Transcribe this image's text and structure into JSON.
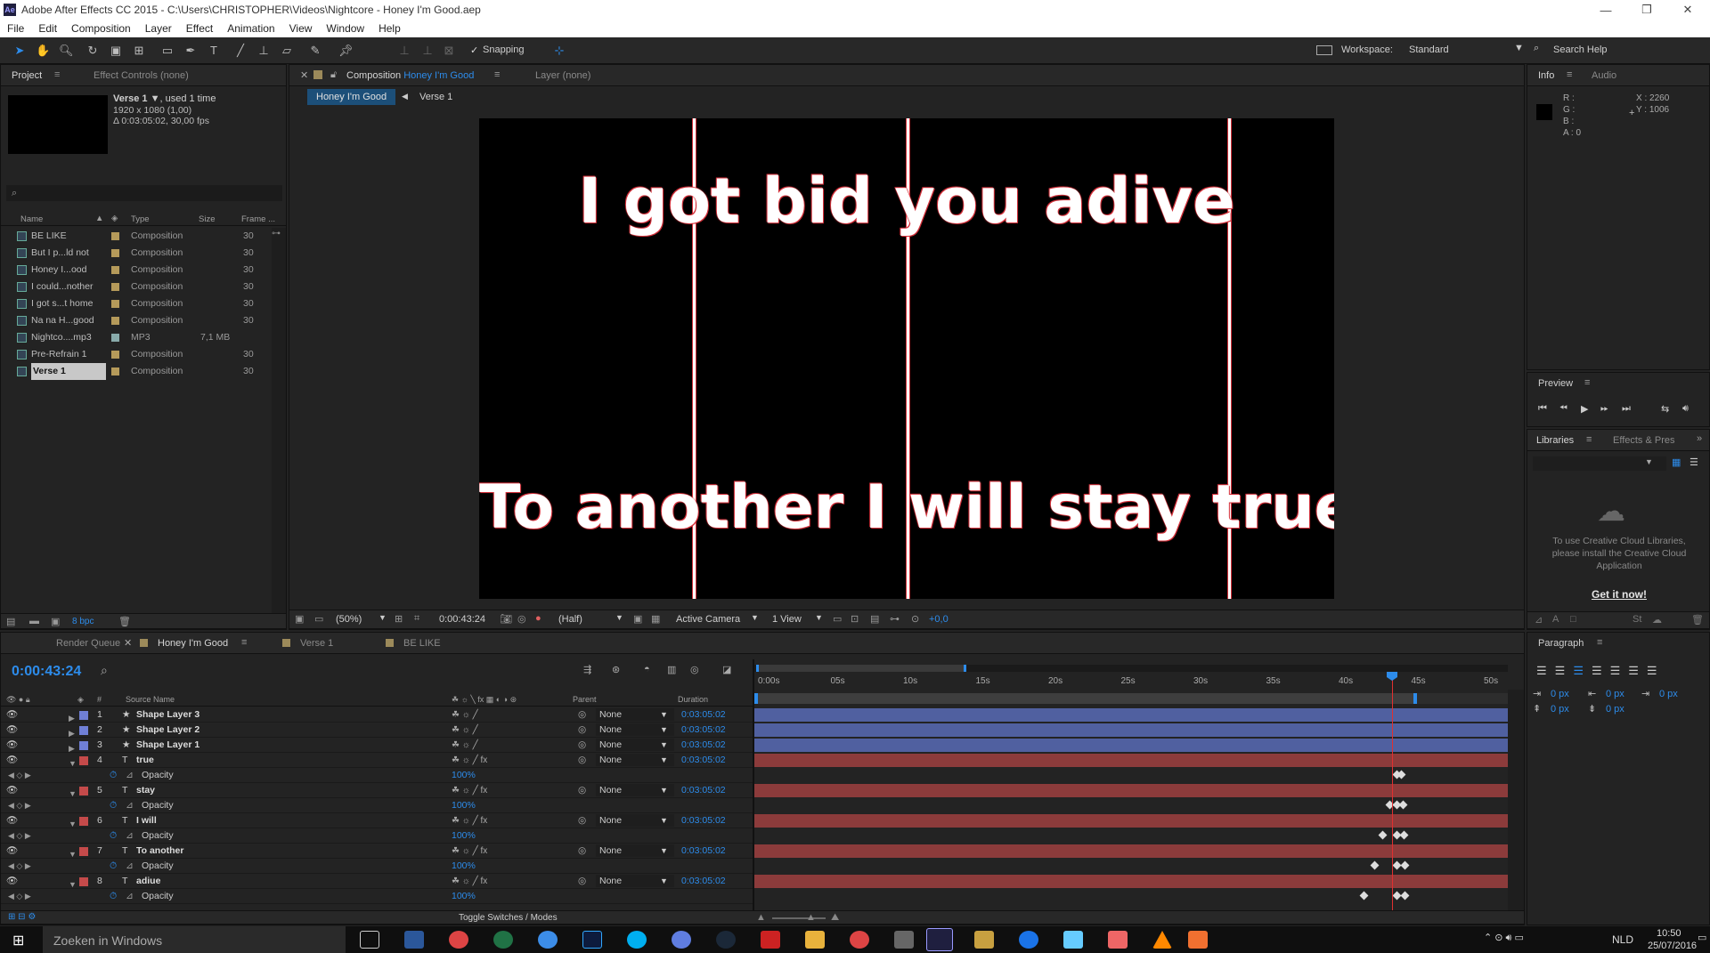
{
  "window": {
    "app_badge": "Ae",
    "title": "Adobe After Effects CC 2015 - C:\\Users\\CHRISTOPHER\\Videos\\Nightcore - Honey I'm Good.aep",
    "min": "—",
    "max": "❐",
    "close": "✕"
  },
  "menu": [
    "File",
    "Edit",
    "Composition",
    "Layer",
    "Effect",
    "Animation",
    "View",
    "Window",
    "Help"
  ],
  "toolbar": {
    "snapping": "Snapping",
    "workspace_label": "Workspace:",
    "workspace_value": "Standard",
    "search_help": "Search Help"
  },
  "project": {
    "tabs": {
      "project": "Project",
      "effect_controls": "Effect Controls (none)"
    },
    "selected_name": "Verse 1 ▼",
    "used": ", used 1 time",
    "dims": "1920 x 1080 (1,00)",
    "duration": "Δ 0:03:05:02, 30,00 fps",
    "columns": {
      "name": "Name",
      "type": "Type",
      "size": "Size",
      "frame": "Frame ..."
    },
    "items": [
      {
        "name": "BE LIKE",
        "type": "Composition",
        "size": "",
        "frame": "30"
      },
      {
        "name": "But I p...ld not",
        "type": "Composition",
        "size": "",
        "frame": "30"
      },
      {
        "name": "Honey I...ood",
        "type": "Composition",
        "size": "",
        "frame": "30"
      },
      {
        "name": "I could...nother",
        "type": "Composition",
        "size": "",
        "frame": "30"
      },
      {
        "name": "I got s...t home",
        "type": "Composition",
        "size": "",
        "frame": "30"
      },
      {
        "name": "Na na H...good",
        "type": "Composition",
        "size": "",
        "frame": "30"
      },
      {
        "name": "Nightco....mp3",
        "type": "MP3",
        "size": "7,1 MB",
        "frame": ""
      },
      {
        "name": "Pre-Refrain 1",
        "type": "Composition",
        "size": "",
        "frame": "30"
      },
      {
        "name": "Verse 1",
        "type": "Composition",
        "size": "",
        "frame": "30"
      }
    ],
    "bpc": "8 bpc"
  },
  "comp": {
    "tab_prefix": "Composition",
    "tab_name": "Honey I'm Good",
    "layer_tab": "Layer (none)",
    "crumb_active": "Honey I'm Good",
    "crumb_next": "Verse 1",
    "text_top": "I got bid you adive",
    "text_bottom": "To another I will stay true",
    "zoom": "(50%)",
    "time": "0:00:43:24",
    "resolution": "(Half)",
    "camera": "Active Camera",
    "views": "1 View",
    "exposure": "+0,0"
  },
  "info": {
    "tab": "Info",
    "tab2": "Audio",
    "r": "R :",
    "g": "G :",
    "b": "B :",
    "a": "A : 0",
    "x": "X : 2260",
    "y": "Y : 1006"
  },
  "preview": {
    "title": "Preview"
  },
  "libraries": {
    "tab": "Libraries",
    "tab2": "Effects & Pres",
    "msg": "To use Creative Cloud Libraries, please install the Creative Cloud Application",
    "link": "Get it now!"
  },
  "paragraph": {
    "title": "Paragraph",
    "v1": "0 px",
    "v2": "0 px",
    "v3": "0 px",
    "v4": "0 px",
    "v5": "0 px"
  },
  "timeline": {
    "tabs": {
      "render": "Render Queue",
      "honey": "Honey I'm Good",
      "verse": "Verse 1",
      "belike": "BE LIKE"
    },
    "timecode": "0:00:43:24",
    "col_source": "Source Name",
    "col_parent": "Parent",
    "col_duration": "Duration",
    "ruler": [
      "0:00s",
      "05s",
      "10s",
      "15s",
      "20s",
      "25s",
      "30s",
      "35s",
      "40s",
      "45s",
      "50s"
    ],
    "layers": [
      {
        "kind": "layer",
        "num": "1",
        "name": "Shape Layer 3",
        "color": "#6f7fd6",
        "parent": "None",
        "dur": "0:03:05:02",
        "icon": "★"
      },
      {
        "kind": "layer",
        "num": "2",
        "name": "Shape Layer 2",
        "color": "#6f7fd6",
        "parent": "None",
        "dur": "0:03:05:02",
        "icon": "★"
      },
      {
        "kind": "layer",
        "num": "3",
        "name": "Shape Layer 1",
        "color": "#6f7fd6",
        "parent": "None",
        "dur": "0:03:05:02",
        "icon": "★"
      },
      {
        "kind": "layer",
        "num": "4",
        "name": "true",
        "color": "#c44a4a",
        "parent": "None",
        "dur": "0:03:05:02",
        "icon": "T"
      },
      {
        "kind": "prop",
        "name": "Opacity",
        "value": "100%"
      },
      {
        "kind": "layer",
        "num": "5",
        "name": "stay",
        "color": "#c44a4a",
        "parent": "None",
        "dur": "0:03:05:02",
        "icon": "T"
      },
      {
        "kind": "prop",
        "name": "Opacity",
        "value": "100%"
      },
      {
        "kind": "layer",
        "num": "6",
        "name": "I will",
        "color": "#c44a4a",
        "parent": "None",
        "dur": "0:03:05:02",
        "icon": "T"
      },
      {
        "kind": "prop",
        "name": "Opacity",
        "value": "100%"
      },
      {
        "kind": "layer",
        "num": "7",
        "name": "To another",
        "color": "#c44a4a",
        "parent": "None",
        "dur": "0:03:05:02",
        "icon": "T"
      },
      {
        "kind": "prop",
        "name": "Opacity",
        "value": "100%"
      },
      {
        "kind": "layer",
        "num": "8",
        "name": "adiue",
        "color": "#c44a4a",
        "parent": "None",
        "dur": "0:03:05:02",
        "icon": "T"
      },
      {
        "kind": "prop",
        "name": "Opacity",
        "value": "100%"
      }
    ],
    "toggle": "Toggle Switches / Modes"
  },
  "taskbar": {
    "search": "Zoeken in Windows",
    "lang": "NLD",
    "time": "10:50",
    "date": "25/07/2016"
  },
  "colors": {
    "accent": "#2d8ceb",
    "shape_bar": "#5060a0",
    "text_bar": "#8c3b3b",
    "playhead": "#e03030"
  }
}
